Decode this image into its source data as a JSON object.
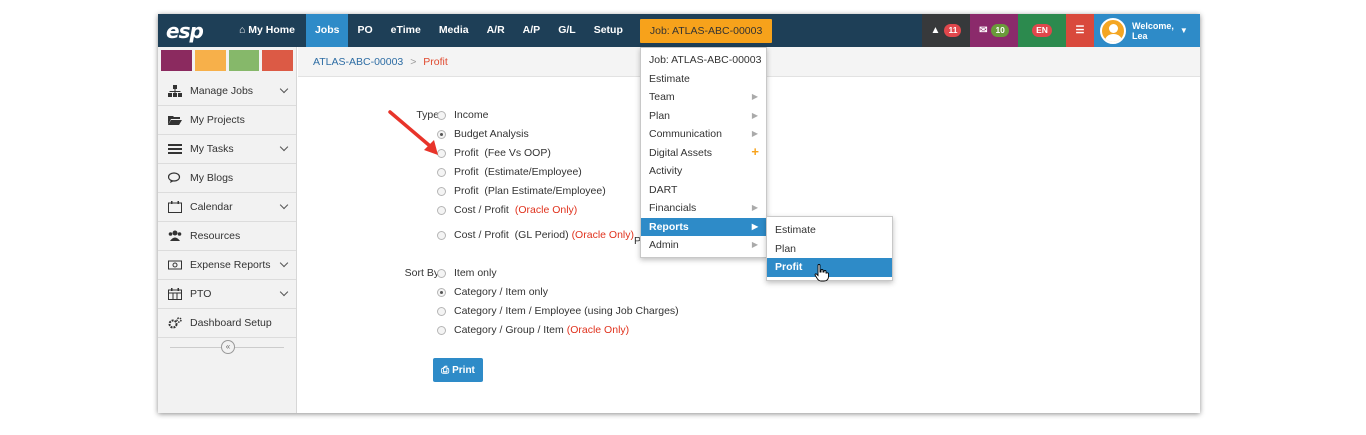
{
  "app": {
    "logo": "esp"
  },
  "topnav": {
    "home": "My Home",
    "items": [
      "Jobs",
      "PO",
      "eTime",
      "Media",
      "A/R",
      "A/P",
      "G/L",
      "Setup"
    ],
    "job": "Job: ATLAS-ABC-00003"
  },
  "notifications": {
    "alerts": "11",
    "messages": "10",
    "language": "EN"
  },
  "user": {
    "welcome": "Welcome,",
    "name": "Lea"
  },
  "swatches": [
    "#8b2a5f",
    "#f7b04a",
    "#86b86a",
    "#dc5a45"
  ],
  "sidebar": {
    "items": [
      {
        "label": "Manage Jobs",
        "icon": "sitemap-icon"
      },
      {
        "label": "My Projects",
        "icon": "folder-open-icon"
      },
      {
        "label": "My Tasks",
        "icon": "tasks-icon"
      },
      {
        "label": "My Blogs",
        "icon": "comments-icon"
      },
      {
        "label": "Calendar",
        "icon": "calendar-icon"
      },
      {
        "label": "Resources",
        "icon": "users-icon"
      },
      {
        "label": "Expense Reports",
        "icon": "money-icon"
      },
      {
        "label": "PTO",
        "icon": "calendar-grid-icon"
      },
      {
        "label": "Dashboard Setup",
        "icon": "cogs-icon"
      }
    ],
    "collapse": "«"
  },
  "breadcrumb": {
    "job": "ATLAS-ABC-00003",
    "separator": ">",
    "current": "Profit"
  },
  "form": {
    "type_label": "Type:",
    "type_options": [
      "Income",
      "Budget Analysis",
      "Profit  (Fee Vs OOP)",
      "Profit  (Estimate/Employee)",
      "Profit  (Plan Estimate/Employee)",
      "Cost / Profit",
      "Cost / Profit  (GL Period)"
    ],
    "oracle_only": "(Oracle Only)",
    "partial_text": "P",
    "sort_label": "Sort By:",
    "sort_options": [
      "Item only",
      "Category / Item only",
      "Category / Item / Employee (using Job Charges)",
      "Category / Group / Item"
    ],
    "print": "Print"
  },
  "job_menu": {
    "items": [
      "Job: ATLAS-ABC-00003",
      "Estimate",
      "Team",
      "Plan",
      "Communication",
      "Digital Assets",
      "Activity",
      "DART",
      "Financials",
      "Reports",
      "Admin"
    ]
  },
  "reports_menu": {
    "items": [
      "Estimate",
      "Plan",
      "Profit"
    ]
  }
}
